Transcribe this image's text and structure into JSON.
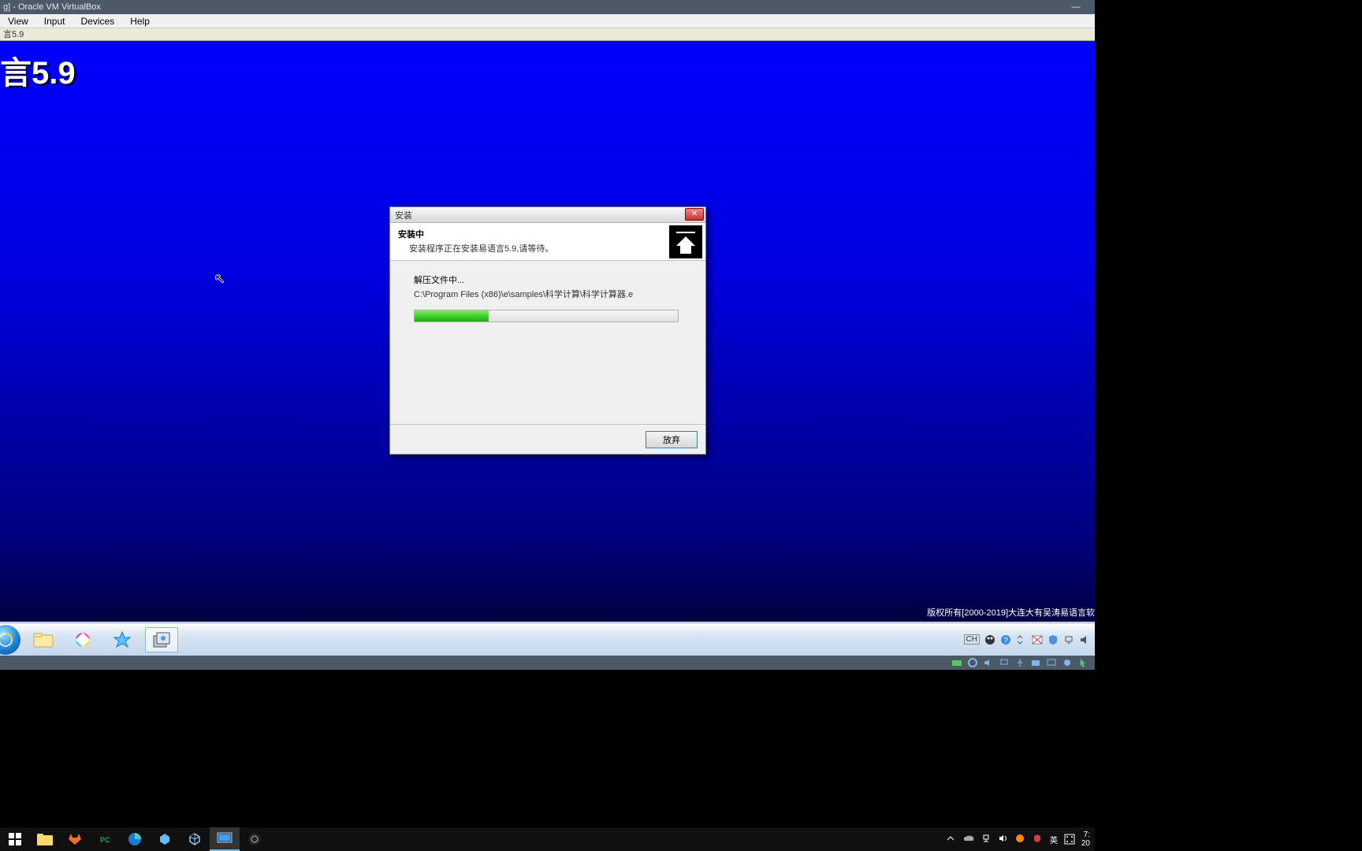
{
  "vbox": {
    "title": "g] - Oracle VM VirtualBox",
    "menu": [
      "View",
      "Input",
      "Devices",
      "Help"
    ]
  },
  "guest": {
    "subtitle": "言5.9",
    "logo": "言5.9",
    "copyright": "版权所有[2000-2019]大连大有吴涛易语言软"
  },
  "installer": {
    "title": "安装",
    "header_title": "安装中",
    "header_sub": "安装程序正在安装易语言5.9,请等待。",
    "status": "解压文件中...",
    "path": "C:\\Program Files (x86)\\e\\samples\\科学计算\\科学计算器.e",
    "progress_percent": 28,
    "abort": "放弃"
  },
  "guest_tray": {
    "ime_lang": "CH",
    "time": ""
  },
  "host_tray": {
    "ime1": "英",
    "time": "7:",
    "date": "20"
  }
}
